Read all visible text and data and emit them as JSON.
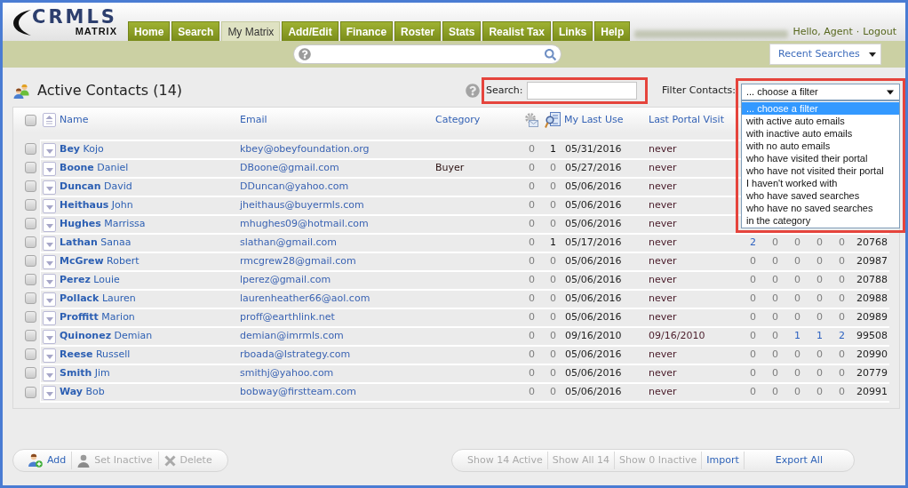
{
  "logo": {
    "name": "CRMLS",
    "sub": "MATRIX"
  },
  "nav_tabs": [
    {
      "label": "Home",
      "selected": false
    },
    {
      "label": "Search",
      "selected": false
    },
    {
      "label": "My Matrix",
      "selected": true
    },
    {
      "label": "Add/Edit",
      "selected": false
    },
    {
      "label": "Finance",
      "selected": false
    },
    {
      "label": "Roster",
      "selected": false
    },
    {
      "label": "Stats",
      "selected": false
    },
    {
      "label": "Realist Tax",
      "selected": false
    },
    {
      "label": "Links",
      "selected": false
    },
    {
      "label": "Help",
      "selected": false
    }
  ],
  "user_links": {
    "greeting": "Hello, Agent",
    "separator": "·",
    "logout": "Logout"
  },
  "recent_searches": {
    "label": "Recent Searches"
  },
  "page": {
    "title": "Active Contacts (14)"
  },
  "search": {
    "label": "Search:",
    "highlighted": true
  },
  "filter": {
    "label": "Filter Contacts:",
    "value": "... choose a filter",
    "expanded": true,
    "highlighted": true,
    "options": [
      {
        "label": "... choose a filter",
        "selected": true
      },
      {
        "label": "with active auto emails",
        "selected": false
      },
      {
        "label": "with inactive auto emails",
        "selected": false
      },
      {
        "label": "with no auto emails",
        "selected": false
      },
      {
        "label": "who have visited their portal",
        "selected": false
      },
      {
        "label": "who have not visited their portal",
        "selected": false
      },
      {
        "label": "I haven't worked with",
        "selected": false
      },
      {
        "label": "who have saved searches",
        "selected": false
      },
      {
        "label": "who have no saved searches",
        "selected": false
      },
      {
        "label": "in the category",
        "selected": false
      }
    ]
  },
  "table": {
    "select_all": {
      "checked": false
    },
    "columns": [
      {
        "kind": "text",
        "label": "Name"
      },
      {
        "kind": "text",
        "label": "Email"
      },
      {
        "kind": "text",
        "label": "Category"
      },
      {
        "kind": "mail"
      },
      {
        "kind": "search"
      },
      {
        "kind": "text",
        "label": "My Last Use"
      },
      {
        "kind": "text",
        "label": "Last Portal Visit"
      }
    ],
    "rows": [
      {
        "checked": false,
        "last": "Bey",
        "first": "Kojo",
        "email": "kbey@obeyfoundation.org",
        "usage": [
          {
            "text": "0",
            "dim": true
          },
          {
            "text": "1",
            "dim": false
          }
        ],
        "last_use": "05/31/2016",
        "portal_visit": "never"
      },
      {
        "checked": false,
        "last": "Boone",
        "first": "Daniel",
        "email": "DBoone@gmail.com",
        "category": "Buyer",
        "usage": [
          {
            "text": "0",
            "dim": true
          },
          {
            "text": "0",
            "dim": true
          }
        ],
        "last_use": "05/27/2016",
        "portal_visit": "never"
      },
      {
        "checked": false,
        "last": "Duncan",
        "first": "David",
        "email": "DDuncan@yahoo.com",
        "usage": [
          {
            "text": "0",
            "dim": true
          },
          {
            "text": "0",
            "dim": true
          }
        ],
        "last_use": "05/06/2016",
        "portal_visit": "never"
      },
      {
        "checked": false,
        "last": "Heithaus",
        "first": "John",
        "email": "jheithaus@buyermls.com",
        "usage": [
          {
            "text": "0",
            "dim": true
          },
          {
            "text": "0",
            "dim": true
          }
        ],
        "last_use": "05/06/2016",
        "portal_visit": "never"
      },
      {
        "checked": false,
        "last": "Hughes",
        "first": "Marrissa",
        "email": "mhughes09@hotmail.com",
        "usage": [
          {
            "text": "0",
            "dim": true
          },
          {
            "text": "0",
            "dim": true
          }
        ],
        "last_use": "05/06/2016",
        "portal_visit": "never"
      },
      {
        "checked": false,
        "last": "Lathan",
        "first": "Sanaa",
        "email": "slathan@gmail.com",
        "usage": [
          {
            "text": "0",
            "dim": true
          },
          {
            "text": "1",
            "dim": false
          }
        ],
        "last_use": "05/17/2016",
        "portal_visit": "never",
        "activity": [
          {
            "text": "2",
            "dim": false
          },
          {
            "text": "0",
            "dim": true
          },
          {
            "text": "0",
            "dim": true
          },
          {
            "text": "0",
            "dim": true
          },
          {
            "text": "0",
            "dim": true
          }
        ],
        "id": "20768"
      },
      {
        "checked": false,
        "last": "McGrew",
        "first": "Robert",
        "email": "rmcgrew28@gmail.com",
        "usage": [
          {
            "text": "0",
            "dim": true
          },
          {
            "text": "0",
            "dim": true
          }
        ],
        "last_use": "05/06/2016",
        "portal_visit": "never",
        "activity": [
          {
            "text": "0",
            "dim": true
          },
          {
            "text": "0",
            "dim": true
          },
          {
            "text": "0",
            "dim": true
          },
          {
            "text": "0",
            "dim": true
          },
          {
            "text": "0",
            "dim": true
          }
        ],
        "id": "20987"
      },
      {
        "checked": false,
        "last": "Perez",
        "first": "Louie",
        "email": "lperez@gmail.com",
        "usage": [
          {
            "text": "0",
            "dim": true
          },
          {
            "text": "0",
            "dim": true
          }
        ],
        "last_use": "05/06/2016",
        "portal_visit": "never",
        "activity": [
          {
            "text": "0",
            "dim": true
          },
          {
            "text": "0",
            "dim": true
          },
          {
            "text": "0",
            "dim": true
          },
          {
            "text": "0",
            "dim": true
          },
          {
            "text": "0",
            "dim": true
          }
        ],
        "id": "20788"
      },
      {
        "checked": false,
        "last": "Pollack",
        "first": "Lauren",
        "email": "laurenheather66@aol.com",
        "usage": [
          {
            "text": "0",
            "dim": true
          },
          {
            "text": "0",
            "dim": true
          }
        ],
        "last_use": "05/06/2016",
        "portal_visit": "never",
        "activity": [
          {
            "text": "0",
            "dim": true
          },
          {
            "text": "0",
            "dim": true
          },
          {
            "text": "0",
            "dim": true
          },
          {
            "text": "0",
            "dim": true
          },
          {
            "text": "0",
            "dim": true
          }
        ],
        "id": "20988"
      },
      {
        "checked": false,
        "last": "Proffitt",
        "first": "Marion",
        "email": "proff@earthlink.net",
        "usage": [
          {
            "text": "0",
            "dim": true
          },
          {
            "text": "0",
            "dim": true
          }
        ],
        "last_use": "05/06/2016",
        "portal_visit": "never",
        "activity": [
          {
            "text": "0",
            "dim": true
          },
          {
            "text": "0",
            "dim": true
          },
          {
            "text": "0",
            "dim": true
          },
          {
            "text": "0",
            "dim": true
          },
          {
            "text": "0",
            "dim": true
          }
        ],
        "id": "20989"
      },
      {
        "checked": false,
        "last": "Quinonez",
        "first": "Demian",
        "email": "demian@imrmls.com",
        "usage": [
          {
            "text": "0",
            "dim": true
          },
          {
            "text": "0",
            "dim": true
          }
        ],
        "last_use": "09/16/2010",
        "portal_visit": "09/16/2010",
        "activity": [
          {
            "text": "0",
            "dim": true
          },
          {
            "text": "0",
            "dim": true
          },
          {
            "text": "1",
            "dim": false
          },
          {
            "text": "1",
            "dim": false
          },
          {
            "text": "2",
            "dim": false
          }
        ],
        "id": "99508"
      },
      {
        "checked": false,
        "last": "Reese",
        "first": "Russell",
        "email": "rboada@Istrategy.com",
        "usage": [
          {
            "text": "0",
            "dim": true
          },
          {
            "text": "0",
            "dim": true
          }
        ],
        "last_use": "05/06/2016",
        "portal_visit": "never",
        "activity": [
          {
            "text": "0",
            "dim": true
          },
          {
            "text": "0",
            "dim": true
          },
          {
            "text": "0",
            "dim": true
          },
          {
            "text": "0",
            "dim": true
          },
          {
            "text": "0",
            "dim": true
          }
        ],
        "id": "20990"
      },
      {
        "checked": false,
        "last": "Smith",
        "first": "Jim",
        "email": "smithj@yahoo.com",
        "usage": [
          {
            "text": "0",
            "dim": true
          },
          {
            "text": "0",
            "dim": true
          }
        ],
        "last_use": "05/06/2016",
        "portal_visit": "never",
        "activity": [
          {
            "text": "0",
            "dim": true
          },
          {
            "text": "0",
            "dim": true
          },
          {
            "text": "0",
            "dim": true
          },
          {
            "text": "0",
            "dim": true
          },
          {
            "text": "0",
            "dim": true
          }
        ],
        "id": "20779"
      },
      {
        "checked": false,
        "last": "Way",
        "first": "Bob",
        "email": "bobway@firstteam.com",
        "usage": [
          {
            "text": "0",
            "dim": true
          },
          {
            "text": "0",
            "dim": true
          }
        ],
        "last_use": "05/06/2016",
        "portal_visit": "never",
        "activity": [
          {
            "text": "0",
            "dim": true
          },
          {
            "text": "0",
            "dim": true
          },
          {
            "text": "0",
            "dim": true
          },
          {
            "text": "0",
            "dim": true
          },
          {
            "text": "0",
            "dim": true
          }
        ],
        "id": "20991"
      }
    ]
  },
  "actions": {
    "left": [
      {
        "kind": "add",
        "label": "Add",
        "disabled": false
      },
      {
        "kind": "inactivate",
        "label": "Set Inactive",
        "disabled": true
      },
      {
        "kind": "delete",
        "label": "Delete",
        "disabled": true
      }
    ],
    "right": [
      {
        "kind": "view",
        "label": "Show 14 Active",
        "disabled": true
      },
      {
        "kind": "view",
        "label": "Show All 14",
        "disabled": true
      },
      {
        "kind": "view",
        "label": "Show 0 Inactive",
        "disabled": true
      },
      {
        "kind": "import",
        "label": "Import",
        "disabled": false
      },
      {
        "kind": "export",
        "label": "Export All",
        "disabled": false
      }
    ]
  }
}
